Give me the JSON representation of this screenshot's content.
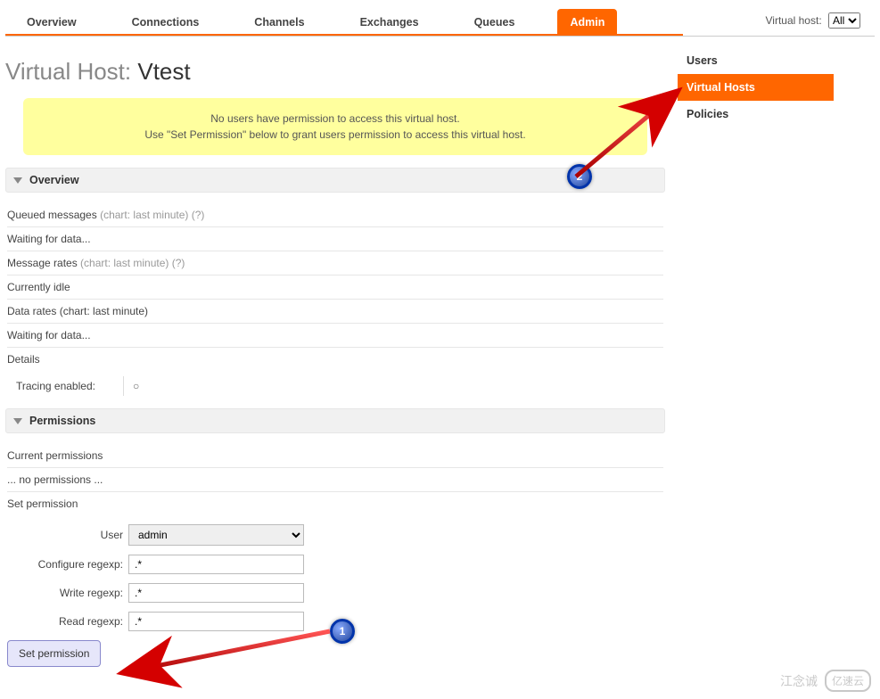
{
  "nav": {
    "tabs": [
      "Overview",
      "Connections",
      "Channels",
      "Exchanges",
      "Queues",
      "Admin"
    ],
    "active_index": 5,
    "vhost_label": "Virtual host:",
    "vhost_selected": "All"
  },
  "sidebar": {
    "items": [
      "Users",
      "Virtual Hosts",
      "Policies"
    ],
    "active_index": 1
  },
  "page": {
    "title_prefix": "Virtual Host: ",
    "title_name": "Vtest"
  },
  "warning": {
    "line1": "No users have permission to access this virtual host.",
    "line2": "Use \"Set Permission\" below to grant users permission to access this virtual host."
  },
  "overview": {
    "header": "Overview",
    "queued_label": "Queued messages",
    "chart_note": " (chart: last minute) ",
    "help": "(?)",
    "waiting": "Waiting for data...",
    "rates_label": "Message rates",
    "idle": "Currently idle",
    "data_rates": "Data rates (chart: last minute)",
    "details": "Details",
    "tracing_label": "Tracing enabled:",
    "tracing_value": "○"
  },
  "permissions": {
    "header": "Permissions",
    "current_label": "Current permissions",
    "no_permissions": "... no permissions ...",
    "set_label": "Set permission",
    "form": {
      "user_label": "User",
      "user_value": "admin",
      "configure_label": "Configure regexp:",
      "configure_value": ".*",
      "write_label": "Write regexp:",
      "write_value": ".*",
      "read_label": "Read regexp:",
      "read_value": ".*",
      "submit": "Set permission"
    }
  },
  "annotations": {
    "step1": "1",
    "step2": "2"
  },
  "watermark": {
    "text": "江念诚",
    "brand": "亿速云"
  }
}
